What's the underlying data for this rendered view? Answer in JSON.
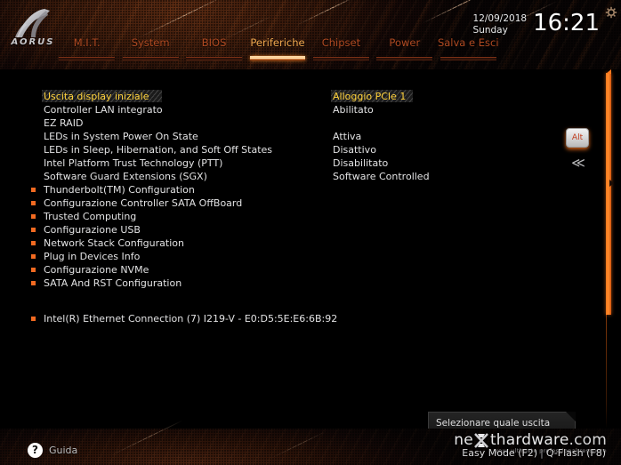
{
  "brand": {
    "logo_text": "AORUS",
    "logo_icon": "aorus-falcon-icon"
  },
  "header": {
    "tabs": [
      {
        "label": "M.I.T.",
        "active": false
      },
      {
        "label": "System",
        "active": false
      },
      {
        "label": "BIOS",
        "active": false
      },
      {
        "label": "Periferiche",
        "active": true
      },
      {
        "label": "Chipset",
        "active": false
      },
      {
        "label": "Power",
        "active": false
      },
      {
        "label": "Salva e Esci",
        "active": false
      }
    ],
    "date": "12/09/2018",
    "weekday": "Sunday",
    "time": "16:21",
    "settings_icon": "gear-icon"
  },
  "main": {
    "rows": [
      {
        "name": "Uscita display iniziale",
        "value": "Alloggio PCIe 1",
        "submenu": false,
        "selected": true
      },
      {
        "name": "Controller LAN integrato",
        "value": "Abilitato",
        "submenu": false,
        "selected": false
      },
      {
        "name": "EZ RAID",
        "value": "",
        "submenu": false,
        "selected": false
      },
      {
        "name": "LEDs in System Power On State",
        "value": "Attiva",
        "submenu": false,
        "selected": false
      },
      {
        "name": "LEDs in Sleep, Hibernation, and Soft Off States",
        "value": "Disattivo",
        "submenu": false,
        "selected": false
      },
      {
        "name": "Intel Platform Trust Technology (PTT)",
        "value": "Disabilitato",
        "submenu": false,
        "selected": false
      },
      {
        "name": "Software Guard Extensions (SGX)",
        "value": "Software Controlled",
        "submenu": false,
        "selected": false
      },
      {
        "name": "Thunderbolt(TM) Configuration",
        "value": "",
        "submenu": true,
        "selected": false
      },
      {
        "name": "Configurazione Controller SATA OffBoard",
        "value": "",
        "submenu": true,
        "selected": false
      },
      {
        "name": "Trusted Computing",
        "value": "",
        "submenu": true,
        "selected": false
      },
      {
        "name": "Configurazione USB",
        "value": "",
        "submenu": true,
        "selected": false
      },
      {
        "name": "Network Stack Configuration",
        "value": "",
        "submenu": true,
        "selected": false
      },
      {
        "name": "Plug in Devices Info",
        "value": "",
        "submenu": true,
        "selected": false
      },
      {
        "name": "Configurazione NVMe",
        "value": "",
        "submenu": true,
        "selected": false
      },
      {
        "name": "SATA And RST Configuration",
        "value": "",
        "submenu": true,
        "selected": false
      }
    ],
    "device_row": {
      "name": "Intel(R) Ethernet Connection (7) I219-V - E0:D5:5E:E6:6B:92",
      "submenu": true
    },
    "alt_key_label": "Alt",
    "collapse_icon": "double-chevron-left-icon",
    "tooltip": "Selezionare quale uscita display video sarà abilitata durante il POST"
  },
  "footer": {
    "help_icon": "question-mark-icon",
    "help_label": "Guida",
    "watermark_a": "ne",
    "watermark_x": "X",
    "watermark_b": "thardware",
    "watermark_tld": ".com",
    "watermark_tagline": "your ultimate professional resource",
    "easy_mode": "Easy Mode (F2)",
    "separator": "|",
    "q_flash": "Q-Flash (F8)"
  },
  "colors": {
    "accent_orange": "#f26a21",
    "selected_yellow": "#ffd23b",
    "tab_inactive": "#b04a22",
    "tab_active": "#f2a94f",
    "text": "#e2e2e3"
  }
}
